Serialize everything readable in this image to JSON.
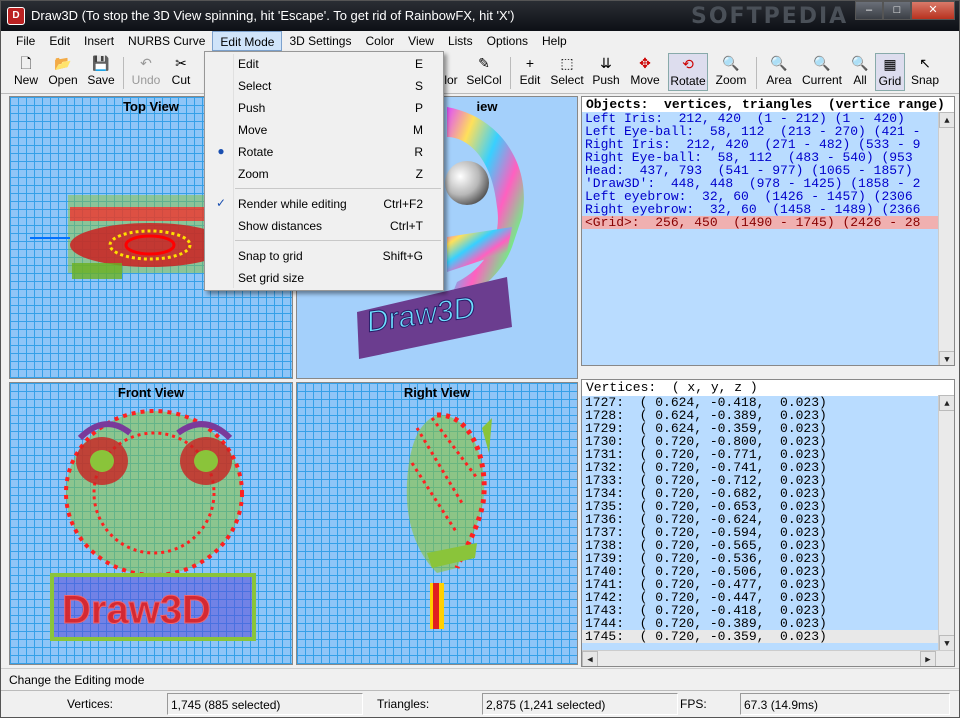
{
  "window": {
    "app_name": "Draw3D",
    "title": "Draw3D     (To stop the 3D View spinning, hit 'Escape'.  To get rid of RainbowFX, hit 'X')",
    "watermark": "SOFTPEDIA",
    "controls": {
      "minimize": "–",
      "maximize": "□",
      "close": "✕"
    }
  },
  "menubar": [
    "File",
    "Edit",
    "Insert",
    "NURBS Curve",
    "Edit Mode",
    "3D Settings",
    "Color",
    "View",
    "Lists",
    "Options",
    "Help"
  ],
  "toolbar": {
    "new": "New",
    "open": "Open",
    "save": "Save",
    "undo": "Undo",
    "cut": "Cut",
    "selcol": "SelCol",
    "edit": "Edit",
    "select": "Select",
    "push": "Push",
    "move": "Move",
    "rotate": "Rotate",
    "zoom": "Zoom",
    "area": "Area",
    "current": "Current",
    "all": "All",
    "grid": "Grid",
    "snap": "Snap",
    "color_partial": "lor"
  },
  "edit_mode_menu": {
    "items": [
      {
        "label": "Edit",
        "shortcut": "E",
        "mark": ""
      },
      {
        "label": "Select",
        "shortcut": "S",
        "mark": ""
      },
      {
        "label": "Push",
        "shortcut": "P",
        "mark": ""
      },
      {
        "label": "Move",
        "shortcut": "M",
        "mark": ""
      },
      {
        "label": "Rotate",
        "shortcut": "R",
        "mark": "●"
      },
      {
        "label": "Zoom",
        "shortcut": "Z",
        "mark": ""
      },
      {
        "label": "Render while editing",
        "shortcut": "Ctrl+F2",
        "mark": "✓"
      },
      {
        "label": "Show distances",
        "shortcut": "Ctrl+T",
        "mark": ""
      },
      {
        "label": "Snap to grid",
        "shortcut": "Shift+G",
        "mark": ""
      },
      {
        "label": "Set grid size",
        "shortcut": "",
        "mark": ""
      }
    ]
  },
  "views": {
    "top": "Top View",
    "persp_partial": "iew",
    "front": "Front View",
    "right": "Right View",
    "persp_text": "Draw3D"
  },
  "objects_panel": {
    "header": "Objects:  vertices, triangles  (vertice range)",
    "lines": [
      "Left Iris:  212, 420  (1 - 212) (1 - 420)",
      "Left Eye-ball:  58, 112  (213 - 270) (421 -",
      "Right Iris:  212, 420  (271 - 482) (533 - 9",
      "Right Eye-ball:  58, 112  (483 - 540) (953",
      "Head:  437, 793  (541 - 977) (1065 - 1857)",
      "'Draw3D':  448, 448  (978 - 1425) (1858 - 2",
      "Left eyebrow:  32, 60  (1426 - 1457) (2306",
      "Right eyebrow:  32, 60  (1458 - 1489) (2366",
      "<Grid>:  256, 450  (1490 - 1745) (2426 - 28"
    ]
  },
  "vertices_panel": {
    "header": "Vertices:  ( x, y, z )",
    "lines": [
      "1727:  ( 0.624, -0.418,  0.023)",
      "1728:  ( 0.624, -0.389,  0.023)",
      "1729:  ( 0.624, -0.359,  0.023)",
      "1730:  ( 0.720, -0.800,  0.023)",
      "1731:  ( 0.720, -0.771,  0.023)",
      "1732:  ( 0.720, -0.741,  0.023)",
      "1733:  ( 0.720, -0.712,  0.023)",
      "1734:  ( 0.720, -0.682,  0.023)",
      "1735:  ( 0.720, -0.653,  0.023)",
      "1736:  ( 0.720, -0.624,  0.023)",
      "1737:  ( 0.720, -0.594,  0.023)",
      "1738:  ( 0.720, -0.565,  0.023)",
      "1739:  ( 0.720, -0.536,  0.023)",
      "1740:  ( 0.720, -0.506,  0.023)",
      "1741:  ( 0.720, -0.477,  0.023)",
      "1742:  ( 0.720, -0.447,  0.023)",
      "1743:  ( 0.720, -0.418,  0.023)",
      "1744:  ( 0.720, -0.389,  0.023)",
      "1745:  ( 0.720, -0.359,  0.023)"
    ]
  },
  "status": {
    "hint": "Change the Editing mode",
    "vertices_label": "Vertices:",
    "vertices_value": "1,745  (885 selected)",
    "triangles_label": "Triangles:",
    "triangles_value": "2,875  (1,241 selected)",
    "fps_label": "FPS:",
    "fps_value": "67.3 (14.9ms)"
  }
}
